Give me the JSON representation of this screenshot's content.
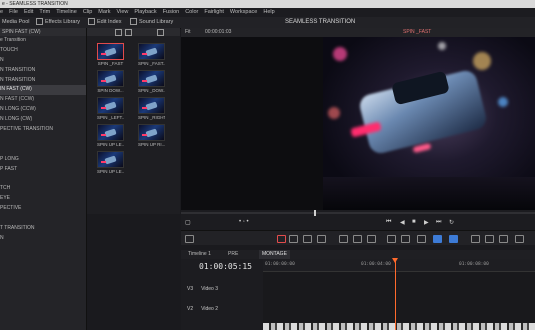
{
  "titlebar": {
    "text": "e - SEAMLESS TRANSITION"
  },
  "menubar": {
    "items": [
      "e",
      "File",
      "Edit",
      "Trim",
      "Timeline",
      "Clip",
      "Mark",
      "View",
      "Playback",
      "Fusion",
      "Color",
      "Fairlight",
      "Workspace",
      "Help"
    ]
  },
  "toolbar": {
    "media_pool": "Media Pool",
    "effects_library": "Effects Library",
    "edit_index": "Edit Index",
    "sound_library": "Sound Library",
    "project_title": "SEAMLESS TRANSITION"
  },
  "left_panel": {
    "header": "SPIN FAST (CW)",
    "items": [
      "e Transition",
      "TOUCH",
      "N",
      "N TRANSITION",
      "N TRANSITION",
      "IN FAST (CW)",
      "N FAST (CCW)",
      "N LONG (CCW)",
      "N LONG (CW)",
      "PECTIVE TRANSITION",
      "",
      "",
      "P LONG",
      "P FAST",
      "",
      "TCH",
      "EYE",
      "PECTIVE",
      "",
      "T TRANSITION",
      "N"
    ],
    "selected_index": 5
  },
  "bin": {
    "clips": [
      {
        "label": "SPIN _FAST",
        "selected": true
      },
      {
        "label": "SPIN _FAST...",
        "selected": false
      },
      {
        "label": "SPIN DOW...",
        "selected": false
      },
      {
        "label": "SPIN _DOW...",
        "selected": false
      },
      {
        "label": "SPIN _LEFT...",
        "selected": false
      },
      {
        "label": "SPIN _RIGHT...",
        "selected": false
      },
      {
        "label": "SPIN UP LE...",
        "selected": false
      },
      {
        "label": "SPIN UP RI...",
        "selected": false
      },
      {
        "label": "SPIN UP LE...",
        "selected": false
      }
    ]
  },
  "viewer": {
    "fit": "Fit",
    "timecode": "00:00:01:03",
    "clip_name": "SPIN _FAST"
  },
  "timeline": {
    "tabs": [
      "Timeline 1",
      "PRE",
      "MONTAGE"
    ],
    "active_tab": 2,
    "timecode": "01:00:05:15",
    "ruler": [
      "01:00:00:00",
      "01:00:04:00",
      "01:00:08:00"
    ],
    "tracks": [
      {
        "id": "V3",
        "name": "Video 3"
      },
      {
        "id": "V2",
        "name": "Video 2"
      }
    ]
  }
}
